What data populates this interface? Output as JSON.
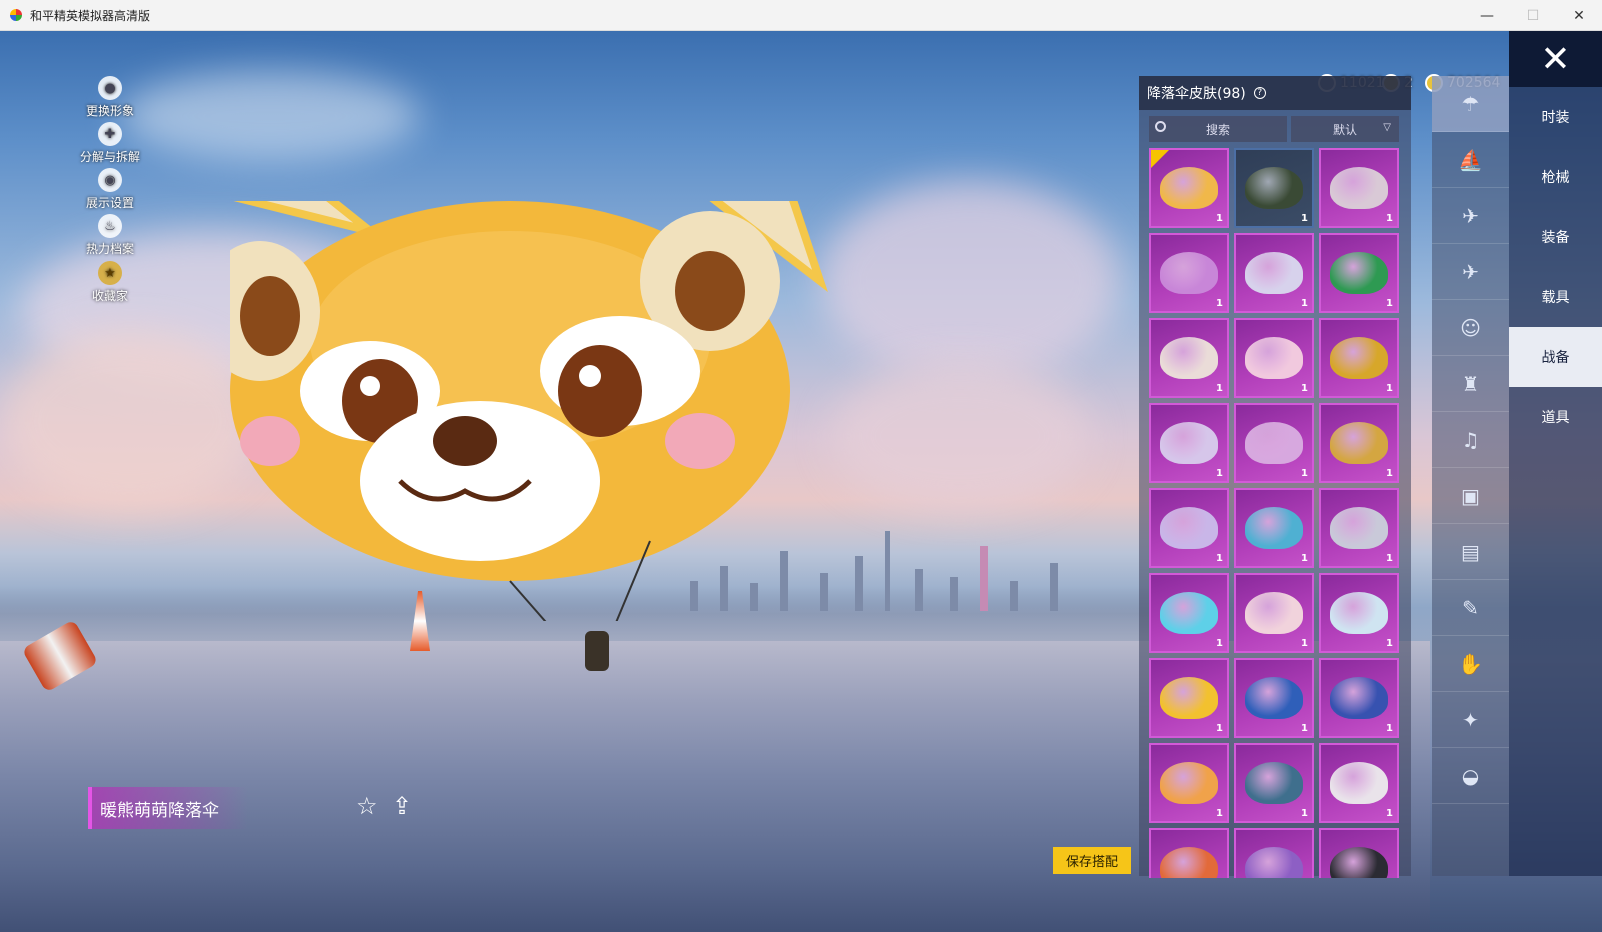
{
  "window": {
    "title": "和平精英模拟器高清版",
    "minimize": "—",
    "maximize": "☐",
    "close": "✕"
  },
  "left_menu": [
    {
      "label": "更换形象",
      "icon": "person-icon"
    },
    {
      "label": "分解与拆解",
      "icon": "puzzle-icon"
    },
    {
      "label": "展示设置",
      "icon": "eye-icon"
    },
    {
      "label": "热力档案",
      "icon": "flame-icon"
    },
    {
      "label": "收藏家",
      "icon": "medal-icon"
    }
  ],
  "currency": [
    {
      "value": "11021",
      "icon": "gem-icon",
      "color": "#6a7fa8"
    },
    {
      "value": "2",
      "icon": "coupon-icon",
      "color": "#c9a227"
    },
    {
      "value": "702564",
      "icon": "coin-icon",
      "color": "#e8c33a"
    }
  ],
  "panel": {
    "title": "降落伞皮肤(98)",
    "search_label": "搜索",
    "sort_label": "默认",
    "items": [
      {
        "count": "1",
        "color": "#f0b84a",
        "selected": true,
        "dark": false
      },
      {
        "count": "1",
        "color": "#3a4a35",
        "selected": false,
        "dark": true
      },
      {
        "count": "1",
        "color": "#d9c9d6",
        "selected": false,
        "dark": false
      },
      {
        "count": "1",
        "color": "#c886d8",
        "selected": false,
        "dark": false
      },
      {
        "count": "1",
        "color": "#d7d2ec",
        "selected": false,
        "dark": false
      },
      {
        "count": "1",
        "color": "#2e9a52",
        "selected": false,
        "dark": false
      },
      {
        "count": "1",
        "color": "#eadcd8",
        "selected": false,
        "dark": false
      },
      {
        "count": "1",
        "color": "#f1c9de",
        "selected": false,
        "dark": false
      },
      {
        "count": "1",
        "color": "#d7a72a",
        "selected": false,
        "dark": false
      },
      {
        "count": "1",
        "color": "#d6c6ea",
        "selected": false,
        "dark": false
      },
      {
        "count": "1",
        "color": "#d7a8df",
        "selected": false,
        "dark": false
      },
      {
        "count": "1",
        "color": "#d4a641",
        "selected": false,
        "dark": false
      },
      {
        "count": "1",
        "color": "#c9b6e8",
        "selected": false,
        "dark": false
      },
      {
        "count": "1",
        "color": "#4fb0d2",
        "selected": false,
        "dark": false
      },
      {
        "count": "1",
        "color": "#c9c9d9",
        "selected": false,
        "dark": false
      },
      {
        "count": "1",
        "color": "#5ed0e8",
        "selected": false,
        "dark": false
      },
      {
        "count": "1",
        "color": "#f1d3dc",
        "selected": false,
        "dark": false
      },
      {
        "count": "1",
        "color": "#cfe4f1",
        "selected": false,
        "dark": false
      },
      {
        "count": "1",
        "color": "#f2c12f",
        "selected": false,
        "dark": false
      },
      {
        "count": "1",
        "color": "#2f5fb9",
        "selected": false,
        "dark": false
      },
      {
        "count": "1",
        "color": "#3752b0",
        "selected": false,
        "dark": false
      },
      {
        "count": "1",
        "color": "#f0a24a",
        "selected": false,
        "dark": false
      },
      {
        "count": "1",
        "color": "#3f6f8d",
        "selected": false,
        "dark": false
      },
      {
        "count": "1",
        "color": "#e9e3ea",
        "selected": false,
        "dark": false
      },
      {
        "count": "",
        "color": "#e26a3a",
        "selected": false,
        "dark": false
      },
      {
        "count": "",
        "color": "#8d5fc4",
        "selected": false,
        "dark": false
      },
      {
        "count": "",
        "color": "#2b2b33",
        "selected": false,
        "dark": false
      }
    ]
  },
  "icon_tabs": [
    "parachute-icon",
    "boat-icon",
    "drone-icon",
    "plane-icon",
    "emote-icon",
    "backpack-icon",
    "voice-icon",
    "chat-icon",
    "gallery-icon",
    "spray-icon",
    "gesture-icon",
    "magic-icon",
    "helmet-icon"
  ],
  "categories": [
    {
      "label": "时装",
      "active": false
    },
    {
      "label": "枪械",
      "active": false
    },
    {
      "label": "装备",
      "active": false
    },
    {
      "label": "载具",
      "active": false
    },
    {
      "label": "战备",
      "active": true
    },
    {
      "label": "道具",
      "active": false
    }
  ],
  "skin_name": "暖熊萌萌降落伞",
  "save_label": "保存搭配",
  "close_label": "✕",
  "fav_icon": "☆",
  "share_icon": "⇪"
}
